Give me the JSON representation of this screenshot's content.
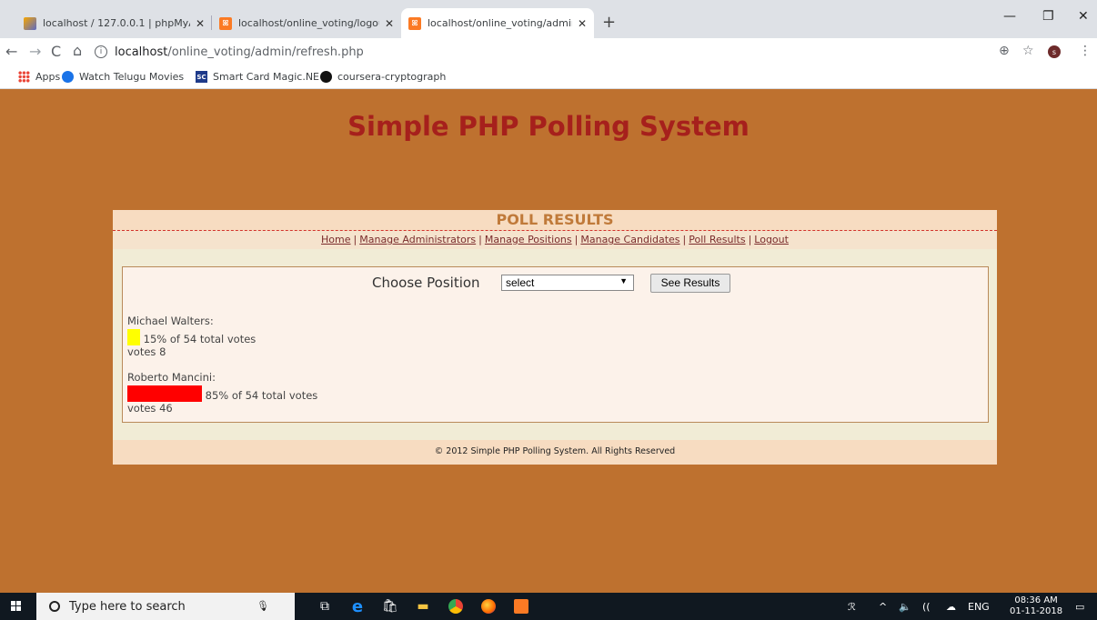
{
  "browser": {
    "tabs": [
      {
        "label": "localhost / 127.0.0.1 | phpMyAdm",
        "favicon": "phpmyadmin-icon"
      },
      {
        "label": "localhost/online_voting/logout.p",
        "favicon": "xampp-icon"
      },
      {
        "label": "localhost/online_voting/admin/re",
        "favicon": "xampp-icon"
      }
    ],
    "url_host": "localhost",
    "url_path": "/online_voting/admin/refresh.php",
    "avatar_letter": "s",
    "bookmarks": [
      {
        "label": "Apps",
        "icon": "apps-grid-icon"
      },
      {
        "label": "Watch Telugu Movies",
        "icon": "play-icon"
      },
      {
        "label": "Smart Card Magic.NE",
        "icon": "sc-icon"
      },
      {
        "label": "coursera-cryptograph",
        "icon": "github-icon"
      }
    ]
  },
  "page": {
    "site_title": "Simple PHP Polling System",
    "panel_title": "POLL RESULTS",
    "nav": [
      "Home",
      "Manage Administrators",
      "Manage Positions",
      "Manage Candidates",
      "Poll Results",
      "Logout"
    ],
    "choose_label": "Choose Position",
    "select_value": "select",
    "see_results_label": "See Results",
    "candidates": [
      {
        "name": "Michael Walters:",
        "percent_text": "15% of 54 total votes",
        "votes_text": "votes 8",
        "bar_color": "#ffff00",
        "votes": 8,
        "total": 54,
        "percent": 15
      },
      {
        "name": "Roberto Mancini:",
        "percent_text": "85% of 54 total votes",
        "votes_text": "votes 46",
        "bar_color": "#ff0000",
        "votes": 46,
        "total": 54,
        "percent": 85
      }
    ],
    "footer": "© 2012 Simple PHP Polling System. All Rights Reserved"
  },
  "taskbar": {
    "search_placeholder": "Type here to search",
    "lang": "ENG",
    "time": "08:36 AM",
    "date": "01-11-2018"
  }
}
